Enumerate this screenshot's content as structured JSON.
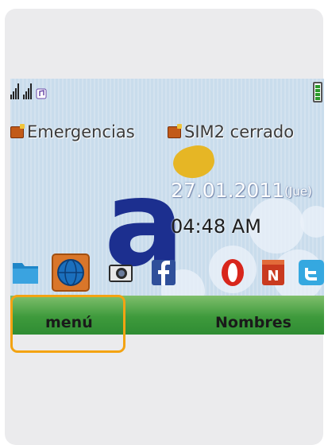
{
  "status_bar": {
    "icons": [
      "signal-sim1-icon",
      "signal-sim2-icon",
      "music-icon",
      "battery-icon"
    ],
    "battery_level": 0.8
  },
  "sim_status": {
    "sim1_label": "Emergencias",
    "sim2_label": "SIM2 cerrado"
  },
  "clock": {
    "date": "27.01.2011",
    "weekday": "(Jue)",
    "time": "04:48 AM"
  },
  "apps": [
    {
      "icon": "folder-icon"
    },
    {
      "icon": "browser-globe-icon",
      "selected": true
    },
    {
      "icon": "camera-icon"
    },
    {
      "icon": "facebook-icon"
    },
    {
      "icon": "opera-icon"
    },
    {
      "icon": "news-icon"
    },
    {
      "icon": "twitter-icon"
    }
  ],
  "softkeys": {
    "left": "menú",
    "right": "Nombres"
  },
  "colors": {
    "highlight": "#f3a312",
    "softbar": "#3e9a3c",
    "brand_a": "#1c2f8f",
    "brand_dot": "#e6b625"
  }
}
